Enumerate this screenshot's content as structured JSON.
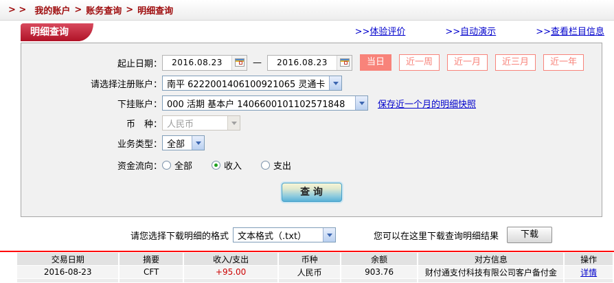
{
  "breadcrumb": {
    "prefix": "> >",
    "separator": ">",
    "items": [
      "我的账户",
      "账务查询",
      "明细查询"
    ]
  },
  "tab": {
    "label": "明细查询"
  },
  "header_links": {
    "prefix": ">>",
    "items": [
      "体验评价",
      "自动演示",
      "查看栏目信息"
    ]
  },
  "form": {
    "date_label": "起止日期：",
    "date_from": "2016.08.23",
    "date_to": "2016.08.23",
    "date_separator": "—",
    "quick_buttons": [
      {
        "label": "当日",
        "active": true
      },
      {
        "label": "近一周",
        "active": false
      },
      {
        "label": "近一月",
        "active": false
      },
      {
        "label": "近三月",
        "active": false
      },
      {
        "label": "近一年",
        "active": false
      }
    ],
    "register_account_label": "请选择注册账户：",
    "register_account_value": "南平  6222001406100921065  灵通卡",
    "sub_account_label": "下挂账户：",
    "sub_account_value": "000  活期  基本户  1406600101102571848",
    "snapshot_link": "保存近一个月的明细快照",
    "currency_label": "币　种：",
    "currency_value": "人民币",
    "business_type_label": "业务类型：",
    "business_type_value": "全部",
    "flow_label": "资金流向：",
    "flow_options": [
      {
        "label": "全部",
        "checked": false
      },
      {
        "label": "收入",
        "checked": true
      },
      {
        "label": "支出",
        "checked": false
      }
    ],
    "query_button": "查 询"
  },
  "download": {
    "format_label": "请您选择下载明细的格式",
    "format_value": "文本格式（.txt）",
    "hint": "您可以在这里下载查询明细结果",
    "button_label": "下载"
  },
  "table": {
    "headers": [
      "交易日期",
      "摘要",
      "收入/支出",
      "币种",
      "余额",
      "对方信息",
      "操作"
    ],
    "rows": [
      {
        "date": "2016-08-23",
        "summary": "CFT",
        "amount": "+95.00",
        "currency": "人民币",
        "balance": "903.76",
        "counterparty": "财付通支付科技有限公司客户备付金",
        "action": "详情"
      }
    ]
  },
  "colors": {
    "accent_red": "#b01226",
    "link_blue": "#0000cc",
    "salmon": "#f8837a",
    "amount_red": "#cc0000",
    "line_red": "#ff0000"
  }
}
